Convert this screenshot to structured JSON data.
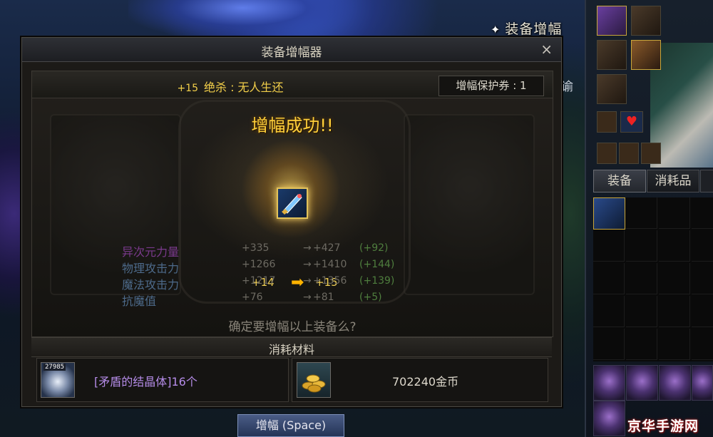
{
  "hud": {
    "enhance_label": "装备增幅",
    "side_text": "编谕"
  },
  "dialog": {
    "title": "装备增幅器",
    "close_label": "×",
    "item": {
      "level": "+15",
      "name": "绝杀 : 无人生还"
    },
    "protection_ticket": "增幅保护券 : 1",
    "result_text": "增幅成功!!",
    "level_from": "+14",
    "level_to": "+15",
    "stats": [
      {
        "name": "异次元力量",
        "from": "+335",
        "to": "+427",
        "delta": "(+92)",
        "color": "#7a3a8c"
      },
      {
        "name": "物理攻击力",
        "from": "+1266",
        "to": "+1410",
        "delta": "(+144)",
        "color": "#4d6a8a"
      },
      {
        "name": "魔法攻击力",
        "from": "+1217",
        "to": "+1356",
        "delta": "(+139)",
        "color": "#4d6a8a"
      },
      {
        "name": "抗魔值",
        "from": "+76",
        "to": "+81",
        "delta": "(+5)",
        "color": "#4d6a8a"
      }
    ],
    "confirm_text": "确定要增幅以上装备么?",
    "materials_header": "消耗材料",
    "material_qty": "27985",
    "material_name": "[矛盾的结晶体]16个",
    "gold_text": "702240金币",
    "enhance_button": "增幅 (Space)"
  },
  "inventory": {
    "tabs": [
      "装备",
      "消耗品"
    ]
  },
  "watermark": "京华手游网"
}
